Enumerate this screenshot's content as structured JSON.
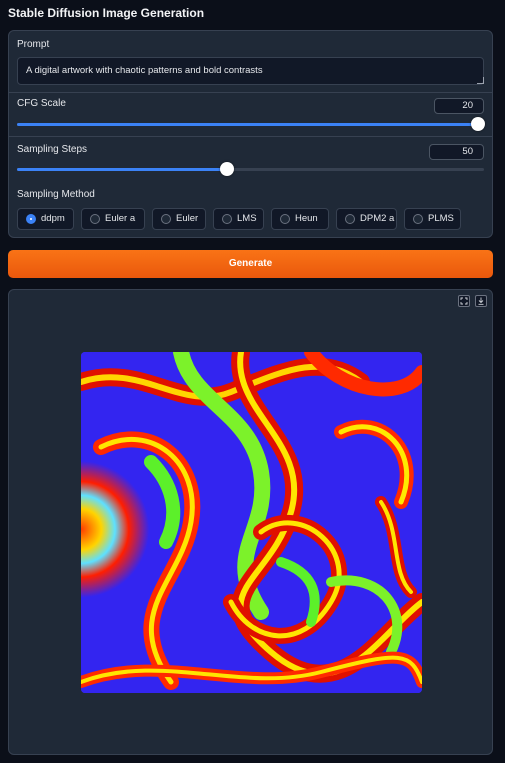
{
  "app": {
    "title": "Stable Diffusion Image Generation"
  },
  "prompt": {
    "label": "Prompt",
    "value": "A digital artwork with chaotic patterns and bold contrasts"
  },
  "cfg_scale": {
    "label": "CFG Scale",
    "value": "20",
    "min": 1,
    "max": 20,
    "fill_fraction": 1.0
  },
  "sampling_steps": {
    "label": "Sampling Steps",
    "value": "50",
    "min": 1,
    "max": 150,
    "fill_fraction": 0.45
  },
  "sampling_method": {
    "label": "Sampling Method",
    "options": [
      "ddpm",
      "Euler a",
      "Euler",
      "LMS",
      "Heun",
      "DPM2 a",
      "PLMS"
    ],
    "selected": "ddpm"
  },
  "generate_button": {
    "label": "Generate"
  },
  "output": {
    "icons": [
      "fullscreen-icon",
      "download-icon"
    ],
    "image_alt": "generated-image"
  },
  "colors": {
    "background": "#0b0f19",
    "panel": "#1f2937",
    "accent": "#3b82f6",
    "generate": "#f97316"
  }
}
